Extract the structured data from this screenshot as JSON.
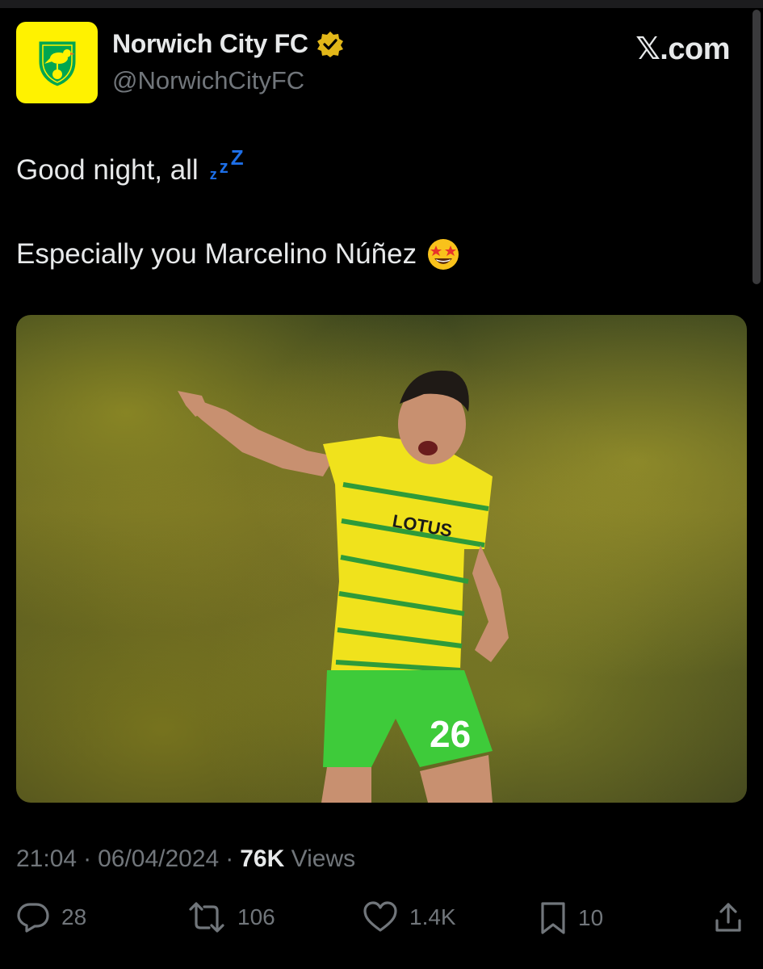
{
  "account": {
    "name": "Norwich City FC",
    "handle": "@NorwichCityFC",
    "verified_badge": "gold-verified-badge-icon",
    "avatar_icon": "norwich-canary-crest-icon",
    "avatar_bg": "#fff200"
  },
  "brand": {
    "label": "𝕏.com"
  },
  "post": {
    "line1": "Good night, all",
    "line1_emoji": "zzz-emoji-icon",
    "line2": "Especially you Marcelino Núñez",
    "line2_emoji": "star-struck-emoji-icon",
    "image_icon": "football-player-photo"
  },
  "meta": {
    "time": "21:04",
    "sep1": "·",
    "date": "06/04/2024",
    "sep2": "·",
    "views_count": "76K",
    "views_label": "Views"
  },
  "actions": {
    "replies": "28",
    "reposts": "106",
    "likes": "1.4K",
    "bookmarks": "10"
  },
  "colors": {
    "background": "#000000",
    "text": "#e7e9ea",
    "muted": "#71767b",
    "accent_blue": "#1d6fe8",
    "gold": "#e2b719"
  }
}
